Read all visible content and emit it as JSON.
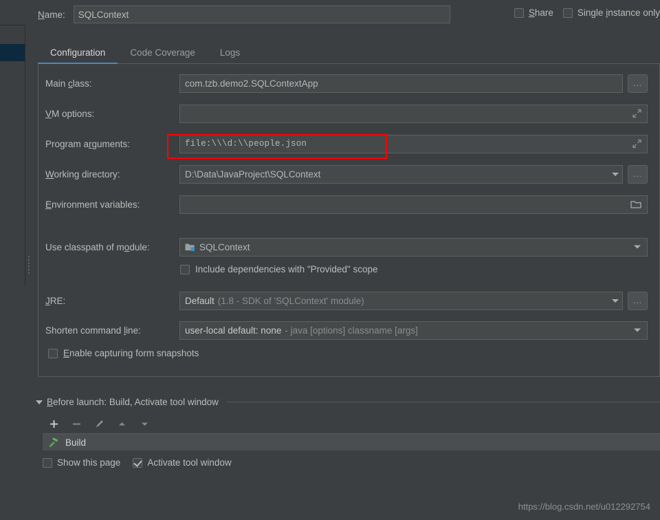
{
  "window": {
    "theme_bg": "#3c3f41",
    "accent": "#4a88c7",
    "highlight_box_color": "#ff0000"
  },
  "header": {
    "name_label": "Name:",
    "name_value": "SQLContext",
    "share_label": "Share",
    "share_checked": false,
    "single_instance_label": "Single instance only",
    "single_instance_checked": false
  },
  "tabs": [
    {
      "label": "Configuration",
      "active": true
    },
    {
      "label": "Code Coverage",
      "active": false
    },
    {
      "label": "Logs",
      "active": false
    }
  ],
  "form": {
    "main_class": {
      "label": "Main class:",
      "value": "com.tzb.demo2.SQLContextApp",
      "browse_label": "..."
    },
    "vm_options": {
      "label": "VM options:",
      "value": "",
      "expand_icon": "expand-icon"
    },
    "program_arguments": {
      "label": "Program arguments:",
      "value": "file:\\\\\\d:\\\\people.json",
      "expand_icon": "expand-icon",
      "highlighted": true
    },
    "working_directory": {
      "label": "Working directory:",
      "value": "D:\\Data\\JavaProject\\SQLContext",
      "browse_label": "..."
    },
    "environment_variables": {
      "label": "Environment variables:",
      "value": "",
      "folder_icon": "folder-icon"
    },
    "use_classpath_of_module": {
      "label": "Use classpath of module:",
      "value": "SQLContext",
      "module_icon": "module-icon"
    },
    "include_provided": {
      "label": "Include dependencies with \"Provided\" scope",
      "checked": false
    },
    "jre": {
      "label": "JRE:",
      "value_bright": "Default",
      "value_dim": "(1.8 - SDK of 'SQLContext' module)",
      "browse_label": "..."
    },
    "shorten_command_line": {
      "label": "Shorten command line:",
      "value_bright": "user-local default: none",
      "value_dim": "- java [options] classname [args]"
    },
    "enable_snapshots": {
      "label": "Enable capturing form snapshots",
      "checked": false
    }
  },
  "before_launch": {
    "title": "Before launch: Build, Activate tool window",
    "toolbar": [
      {
        "name": "add-button",
        "glyph": "+"
      },
      {
        "name": "remove-button",
        "glyph": "−"
      },
      {
        "name": "edit-button",
        "glyph": "pencil"
      },
      {
        "name": "move-up-button",
        "glyph": "up"
      },
      {
        "name": "move-down-button",
        "glyph": "down"
      }
    ],
    "items": [
      {
        "label": "Build",
        "icon": "hammer-icon"
      }
    ],
    "show_this_page": {
      "label": "Show this page",
      "checked": false
    },
    "activate_tool_window": {
      "label": "Activate tool window",
      "checked": true
    }
  },
  "watermark": "https://blog.csdn.net/u012292754"
}
